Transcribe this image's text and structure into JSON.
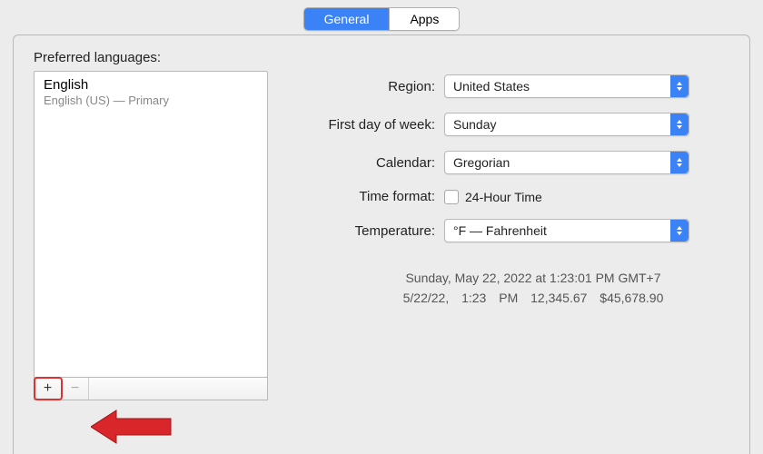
{
  "tabs": {
    "general": "General",
    "apps": "Apps"
  },
  "preferred_languages": {
    "label": "Preferred languages:",
    "items": [
      {
        "name": "English",
        "sub": "English (US) — Primary"
      }
    ]
  },
  "buttons": {
    "add": "+",
    "remove": "−"
  },
  "form": {
    "region": {
      "label": "Region:",
      "value": "United States"
    },
    "first_day": {
      "label": "First day of week:",
      "value": "Sunday"
    },
    "calendar": {
      "label": "Calendar:",
      "value": "Gregorian"
    },
    "time_format": {
      "label": "Time format:",
      "checkbox_label": "24-Hour Time"
    },
    "temperature": {
      "label": "Temperature:",
      "value": "°F — Fahrenheit"
    }
  },
  "example": {
    "line1": "Sunday, May 22, 2022 at 1:23:01 PM GMT+7",
    "line2": "5/22/22, 1:23 PM   12,345.67   $45,678.90"
  }
}
